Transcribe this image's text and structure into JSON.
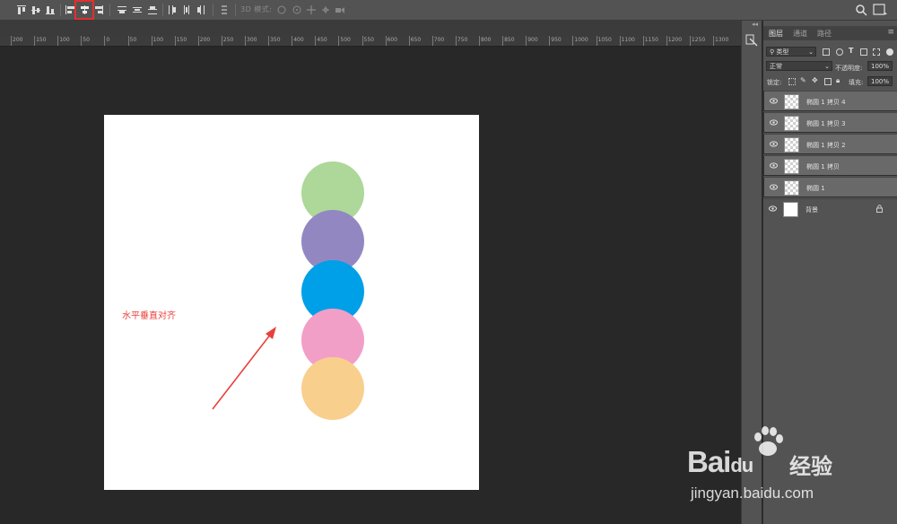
{
  "options_bar": {
    "mode_3d_label": "3D 模式:",
    "icons": [
      "align-top-edges-icon",
      "align-vertical-centers-icon",
      "align-bottom-edges-icon",
      "align-left-edges-icon",
      "align-horizontal-centers-icon",
      "align-right-edges-icon",
      "distribute-top-edges-icon",
      "distribute-vertical-centers-icon",
      "distribute-bottom-edges-icon",
      "distribute-left-edges-icon",
      "distribute-horizontal-centers-icon",
      "distribute-right-edges-icon",
      "auto-align-layers-icon"
    ],
    "active_icon": "align-horizontal-centers-icon"
  },
  "ruler": {
    "labels": [
      "200",
      "150",
      "100",
      "50",
      "0",
      "50",
      "100",
      "150",
      "200",
      "250",
      "300",
      "350",
      "400",
      "450",
      "500",
      "550",
      "600",
      "650",
      "700",
      "750",
      "800",
      "850",
      "900",
      "950",
      "1000",
      "1050",
      "1100",
      "1150",
      "1200",
      "1250",
      "1300"
    ]
  },
  "canvas": {
    "circle_colors": [
      "#aed79a",
      "#9387c2",
      "#00a0e8",
      "#f29fc8",
      "#f9cf8d"
    ],
    "annotation_text": "水平垂直对齐",
    "annotation_color": "#e8413b"
  },
  "layers_panel": {
    "tabs": [
      "图层",
      "通道",
      "路径"
    ],
    "active_tab": "图层",
    "filter_label": "类型",
    "blend_mode": "正常",
    "opacity_label": "不透明度:",
    "opacity_value": "100%",
    "lock_label": "锁定:",
    "fill_label": "填充:",
    "fill_value": "100%",
    "layers": [
      {
        "name": "椭圆 1 拷贝 4",
        "selected": true,
        "thumb": "transparent"
      },
      {
        "name": "椭圆 1 拷贝 3",
        "selected": true,
        "thumb": "transparent"
      },
      {
        "name": "椭圆 1 拷贝 2",
        "selected": true,
        "thumb": "transparent"
      },
      {
        "name": "椭圆 1 拷贝",
        "selected": true,
        "thumb": "transparent"
      },
      {
        "name": "椭圆 1",
        "selected": true,
        "thumb": "transparent"
      },
      {
        "name": "背景",
        "selected": false,
        "thumb": "white",
        "locked": true
      }
    ]
  },
  "watermark": {
    "brand": "Bai",
    "brand_suffix": "du",
    "product": "经验",
    "url": "jingyan.baidu.com"
  }
}
